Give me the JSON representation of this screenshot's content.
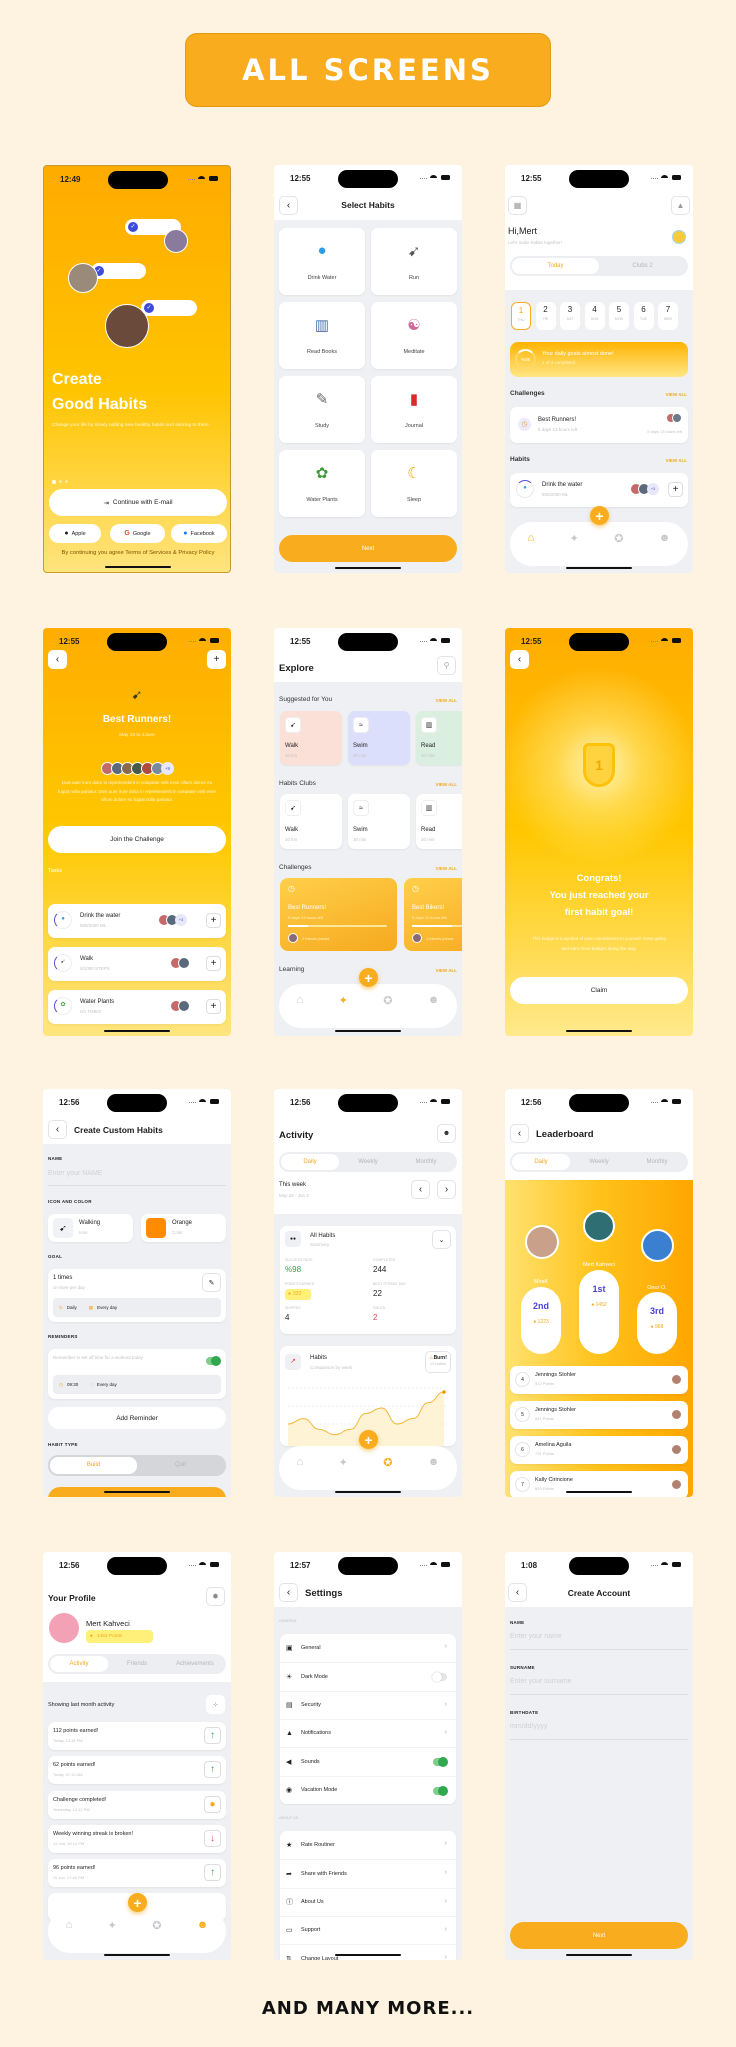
{
  "header": {
    "title": "ALL SCREENS",
    "footer": "AND MANY MORE..."
  },
  "colors": {
    "accent": "#f9ad1e",
    "background": "#fdf3e0",
    "success": "#2fa84f",
    "danger": "#e04848",
    "rank": "#4a43d6"
  },
  "screens": {
    "onboarding": {
      "time": "12:49",
      "title_line1": "Create",
      "title_line2": "Good Habits",
      "subtitle": "Change your life by slowly adding new healthy habits and sticking to them.",
      "continue_label": "Continue with E-mail",
      "apple_label": "Apple",
      "google_label": "Google",
      "facebook_label": "Facebook",
      "terms": "By continuing you agree Terms of Services & Privacy Policy",
      "page_index": 1,
      "page_count": 3
    },
    "select_habits": {
      "time": "12:55",
      "title": "Select Habits",
      "habits": [
        {
          "label": "Drink Water",
          "icon": "water-drop",
          "glyph": "●",
          "color": "#2e9be6"
        },
        {
          "label": "Run",
          "icon": "runner",
          "glyph": "➹",
          "color": "#555"
        },
        {
          "label": "Read Books",
          "icon": "book",
          "glyph": "▥",
          "color": "#4a6fa5"
        },
        {
          "label": "Meditate",
          "icon": "meditation",
          "glyph": "☯",
          "color": "#d0699a"
        },
        {
          "label": "Study",
          "icon": "student-laptop",
          "glyph": "✎",
          "color": "#666"
        },
        {
          "label": "Journal",
          "icon": "journal",
          "glyph": "▮",
          "color": "#d82a2a"
        },
        {
          "label": "Water Plants",
          "icon": "plant",
          "glyph": "✿",
          "color": "#3f9b3a"
        },
        {
          "label": "Sleep",
          "icon": "sleeping-face",
          "glyph": "☾",
          "color": "#f0a800"
        }
      ],
      "next_label": "Next"
    },
    "home": {
      "time": "12:55",
      "greeting": "Hi,Mert",
      "subtitle": "Let's make habits together!",
      "tabs": [
        "Today",
        "Clubs 2"
      ],
      "days": [
        {
          "num": "1",
          "day": "THU"
        },
        {
          "num": "2",
          "day": "FRI"
        },
        {
          "num": "3",
          "day": "SAT"
        },
        {
          "num": "4",
          "day": "SUN"
        },
        {
          "num": "5",
          "day": "MON"
        },
        {
          "num": "6",
          "day": "TUE"
        },
        {
          "num": "7",
          "day": "WED"
        }
      ],
      "goal": {
        "title": "Your daily goals almost done!",
        "subtitle": "1 of 4 completed",
        "percent_label": "%25",
        "progress": 25
      },
      "challenges_heading": "Challenges",
      "view_all": "VIEW ALL",
      "challenge": {
        "title": "Best Runners!",
        "subtitle": "5 days 13 hours left",
        "time_left": "5 days 13 hours left"
      },
      "habits_heading": "Habits",
      "habit": {
        "title": "Drink the water",
        "subtitle": "500/2000 ML",
        "extra_count": "+3"
      }
    },
    "challenge_detail": {
      "time": "12:55",
      "title": "Best Runners!",
      "dates": "May 28 to 4June",
      "extra_members": "+9",
      "description": "Duis aute irure dolor in reprehenderit in voluptate velit esse cillum dolore eu fugiat nulla pariatur. Duis aute irure dolor in reprehenderit in voluptate velit esse cillum dolore eu fugiat nulla pariatur.",
      "join_label": "Join the Challenge",
      "tasks_heading": "Tasks",
      "tasks": [
        {
          "title": "Drink the water",
          "subtitle": "500/2000 ML",
          "extra": "+3",
          "icon": "water-drop",
          "glyph": "●",
          "color": "#2e9be6"
        },
        {
          "title": "Walk",
          "subtitle": "0/1000 STEPS",
          "extra": "",
          "icon": "walk",
          "glyph": "➹",
          "color": "#555"
        },
        {
          "title": "Water Plants",
          "subtitle": "0/1 TIMES",
          "extra": "",
          "icon": "plant",
          "glyph": "✿",
          "color": "#3f9b3a"
        }
      ]
    },
    "explore": {
      "time": "12:55",
      "title": "Explore",
      "view_all": "VIEW ALL",
      "suggested_heading": "Suggested for You",
      "suggested": [
        {
          "label": "Walk",
          "sub": "10 km",
          "color": "#fbe0d8",
          "icon": "walk",
          "glyph": "➹"
        },
        {
          "label": "Swim",
          "sub": "30 min",
          "color": "#dcdffb",
          "icon": "swim",
          "glyph": "≈"
        },
        {
          "label": "Read",
          "sub": "20 min",
          "color": "#dbefe0",
          "icon": "book",
          "glyph": "▥"
        }
      ],
      "clubs_heading": "Habits Clubs",
      "clubs": [
        {
          "label": "Walk",
          "sub": "10 km",
          "icon": "walk",
          "glyph": "➹"
        },
        {
          "label": "Swim",
          "sub": "30 min",
          "icon": "swim",
          "glyph": "≈"
        },
        {
          "label": "Read",
          "sub": "20 min",
          "icon": "book",
          "glyph": "▥"
        }
      ],
      "challenges_heading": "Challenges",
      "challenges": [
        {
          "title": "Best Runners!",
          "sub": "5 days 13 hours left",
          "friends": "2 friends joined",
          "progress": 20
        },
        {
          "title": "Best Bikers!",
          "sub": "5 days 11 hours left",
          "friends": "1 friends joined",
          "progress": 40
        }
      ],
      "learning_heading": "Learning"
    },
    "congrats": {
      "time": "12:55",
      "badge_number": "1",
      "title_lines": [
        "Congrats!",
        "You just reached your",
        "first habit goal!"
      ],
      "description": "This badge is a symbol of your commitment to yourself. Keep going and earn more badges along the way.",
      "claim_label": "Claim"
    },
    "custom_habit": {
      "time": "12:56",
      "title": "Create Custom Habits",
      "name_label": "NAME",
      "name_placeholder": "Enter your NAME",
      "icon_color_label": "ICON AND COLOR",
      "icon": {
        "title": "Walking",
        "sub": "Icon"
      },
      "color": {
        "title": "Orange",
        "sub": "Color",
        "hex": "#ff8c00"
      },
      "goal_label": "GOAL",
      "goal": {
        "title": "1 times",
        "sub": "or more per day",
        "frequency": "Daily",
        "days": "Every day"
      },
      "reminders_label": "REMINDERS",
      "reminder": {
        "text": "Remember to set off time for a workout today",
        "enabled": true,
        "time": "09:30",
        "days": "Every day"
      },
      "add_reminder_label": "Add Reminder",
      "habit_type_label": "HABIT TYPE",
      "habit_types": [
        "Build",
        "Quit"
      ]
    },
    "activity": {
      "time": "12:56",
      "title": "Activity",
      "tabs": [
        "Daily",
        "Weekly",
        "Monthly"
      ],
      "week_title": "This week",
      "week_range": "May 28 - Jun 3",
      "summary": {
        "title": "All Habits",
        "sub": "Summary",
        "stats": [
          {
            "label": "SUCCESS RATE",
            "value": "%98",
            "color": "#2fa84f"
          },
          {
            "label": "COMPLETED",
            "value": "244",
            "color": "#1d1d1f"
          },
          {
            "label": "POINTS EARNED",
            "value": "322",
            "color": "#f2a91c"
          },
          {
            "label": "BEST STREAK DAY",
            "value": "22",
            "color": "#1d1d1f"
          },
          {
            "label": "SKIPPED",
            "value": "4",
            "color": "#1d1d1f"
          },
          {
            "label": "FAILED",
            "value": "2",
            "color": "#e04848"
          }
        ]
      },
      "habits_card": {
        "title": "Habits",
        "sub": "Comparison by week",
        "burn_title": "Burn!",
        "burn_sub": "12 habits"
      },
      "trend": [
        3,
        4,
        2,
        1,
        2,
        5,
        6,
        3,
        4,
        7,
        9
      ]
    },
    "leaderboard": {
      "time": "12:56",
      "title": "Leaderboard",
      "tabs": [
        "Daily",
        "Weekly",
        "Monthly"
      ],
      "podium": [
        {
          "rank": "2nd",
          "name": "MiraK",
          "points": "1223"
        },
        {
          "rank": "1st",
          "name": "Mert Kahveci",
          "points": "1452"
        },
        {
          "rank": "3rd",
          "name": "Onur O.",
          "points": "968"
        }
      ],
      "list": [
        {
          "rank": "4",
          "name": "Jennings Stohler",
          "points": "912 Points"
        },
        {
          "rank": "5",
          "name": "Jennings Stohler",
          "points": "841 Points"
        },
        {
          "rank": "6",
          "name": "Amelina Aguila",
          "points": "731 Points"
        },
        {
          "rank": "7",
          "name": "Kally Cirincione",
          "points": "653 Points"
        }
      ]
    },
    "profile": {
      "time": "12:56",
      "title": "Your Profile",
      "name": "Mert Kahveci",
      "points": "1452 Points",
      "tabs": [
        "Activity",
        "Friends",
        "Achievements"
      ],
      "filter_text": "Showing last month activity",
      "items": [
        {
          "title": "112 points earned!",
          "time": "Today, 12:34 PM",
          "type": "up"
        },
        {
          "title": "62 points earned!",
          "time": "Today, 07:12 AM",
          "type": "up"
        },
        {
          "title": "Challenge completed!",
          "time": "Yesterday, 14:12 PM",
          "type": "medal"
        },
        {
          "title": "Weekly winning streak is broken!",
          "time": "12 Jun, 16:14 PM",
          "type": "down"
        },
        {
          "title": "96 points earned!",
          "time": "11 Jun, 17:45 PM",
          "type": "up"
        }
      ]
    },
    "settings": {
      "time": "12:57",
      "title": "Settings",
      "general_label": "GENERAL",
      "general": [
        {
          "label": "General",
          "type": "chevron",
          "icon": "general-icon",
          "glyph": "▣"
        },
        {
          "label": "Dark Mode",
          "type": "toggle",
          "on": false,
          "icon": "dark-mode-icon",
          "glyph": "☀"
        },
        {
          "label": "Security",
          "type": "chevron",
          "icon": "security-icon",
          "glyph": "▤"
        },
        {
          "label": "Notifications",
          "type": "chevron",
          "icon": "bell-icon",
          "glyph": "▲"
        },
        {
          "label": "Sounds",
          "type": "toggle",
          "on": true,
          "icon": "speaker-icon",
          "glyph": "◀"
        },
        {
          "label": "Vacation Mode",
          "type": "toggle",
          "on": true,
          "icon": "vacation-icon",
          "glyph": "◉"
        }
      ],
      "about_label": "ABOUT US",
      "about": [
        {
          "label": "Rate Routiner",
          "icon": "star-icon",
          "glyph": "★"
        },
        {
          "label": "Share with Friends",
          "icon": "share-icon",
          "glyph": "➦"
        },
        {
          "label": "About Us",
          "icon": "info-icon",
          "glyph": "ⓘ"
        },
        {
          "label": "Support",
          "icon": "chat-icon",
          "glyph": "▭"
        },
        {
          "label": "Change Layout",
          "icon": "layout-icon",
          "glyph": "⇅"
        }
      ]
    },
    "create_account": {
      "time": "1:08",
      "title": "Create Account",
      "fields": [
        {
          "label": "NAME",
          "placeholder": "Enter your name"
        },
        {
          "label": "SURNAME",
          "placeholder": "Enter your surname"
        },
        {
          "label": "BIRTHDATE",
          "placeholder": "mm/dd/yyyy"
        }
      ],
      "next_label": "Next"
    }
  }
}
